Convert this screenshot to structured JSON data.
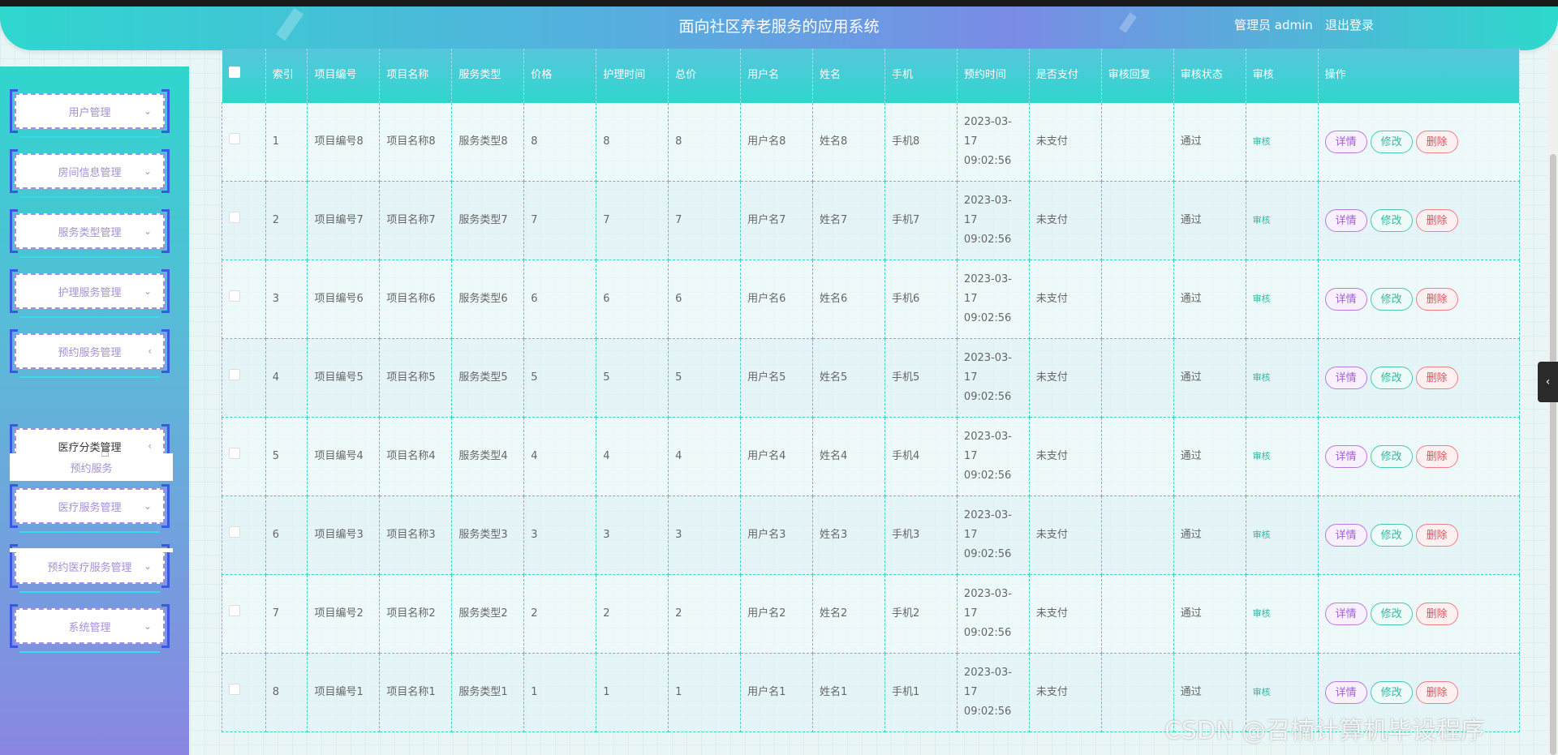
{
  "header": {
    "title": "面向社区养老服务的应用系统",
    "user_label": "管理员 admin",
    "logout_label": "退出登录"
  },
  "sidebar": {
    "items": [
      {
        "label": "用户管理",
        "chevron": "⌄"
      },
      {
        "label": "房间信息管理",
        "chevron": "⌄"
      },
      {
        "label": "服务类型管理",
        "chevron": "⌄"
      },
      {
        "label": "护理服务管理",
        "chevron": "⌄"
      },
      {
        "label": "预约服务管理",
        "chevron": "‹"
      },
      {
        "label": "医疗分类管理",
        "chevron": "‹"
      },
      {
        "label": "医疗服务管理",
        "chevron": "⌄"
      },
      {
        "label": "预约医疗服务管理",
        "chevron": "⌄"
      },
      {
        "label": "系统管理",
        "chevron": "⌄"
      }
    ],
    "sub_item": "预约服务"
  },
  "table": {
    "columns": [
      "索引",
      "项目编号",
      "项目名称",
      "服务类型",
      "价格",
      "护理时间",
      "总价",
      "用户名",
      "姓名",
      "手机",
      "预约时间",
      "是否支付",
      "审核回复",
      "审核状态",
      "审核",
      "操作"
    ],
    "rows": [
      {
        "idx": "1",
        "code": "项目编号8",
        "name": "项目名称8",
        "type": "服务类型8",
        "price": "8",
        "time": "8",
        "total": "8",
        "username": "用户名8",
        "realname": "姓名8",
        "phone": "手机8",
        "date": "2023-03-17 09:02:56",
        "paid": "未支付",
        "reply": "",
        "status": "通过"
      },
      {
        "idx": "2",
        "code": "项目编号7",
        "name": "项目名称7",
        "type": "服务类型7",
        "price": "7",
        "time": "7",
        "total": "7",
        "username": "用户名7",
        "realname": "姓名7",
        "phone": "手机7",
        "date": "2023-03-17 09:02:56",
        "paid": "未支付",
        "reply": "",
        "status": "通过"
      },
      {
        "idx": "3",
        "code": "项目编号6",
        "name": "项目名称6",
        "type": "服务类型6",
        "price": "6",
        "time": "6",
        "total": "6",
        "username": "用户名6",
        "realname": "姓名6",
        "phone": "手机6",
        "date": "2023-03-17 09:02:56",
        "paid": "未支付",
        "reply": "",
        "status": "通过"
      },
      {
        "idx": "4",
        "code": "项目编号5",
        "name": "项目名称5",
        "type": "服务类型5",
        "price": "5",
        "time": "5",
        "total": "5",
        "username": "用户名5",
        "realname": "姓名5",
        "phone": "手机5",
        "date": "2023-03-17 09:02:56",
        "paid": "未支付",
        "reply": "",
        "status": "通过"
      },
      {
        "idx": "5",
        "code": "项目编号4",
        "name": "项目名称4",
        "type": "服务类型4",
        "price": "4",
        "time": "4",
        "total": "4",
        "username": "用户名4",
        "realname": "姓名4",
        "phone": "手机4",
        "date": "2023-03-17 09:02:56",
        "paid": "未支付",
        "reply": "",
        "status": "通过"
      },
      {
        "idx": "6",
        "code": "项目编号3",
        "name": "项目名称3",
        "type": "服务类型3",
        "price": "3",
        "time": "3",
        "total": "3",
        "username": "用户名3",
        "realname": "姓名3",
        "phone": "手机3",
        "date": "2023-03-17 09:02:56",
        "paid": "未支付",
        "reply": "",
        "status": "通过"
      },
      {
        "idx": "7",
        "code": "项目编号2",
        "name": "项目名称2",
        "type": "服务类型2",
        "price": "2",
        "time": "2",
        "total": "2",
        "username": "用户名2",
        "realname": "姓名2",
        "phone": "手机2",
        "date": "2023-03-17 09:02:56",
        "paid": "未支付",
        "reply": "",
        "status": "通过"
      },
      {
        "idx": "8",
        "code": "项目编号1",
        "name": "项目名称1",
        "type": "服务类型1",
        "price": "1",
        "time": "1",
        "total": "1",
        "username": "用户名1",
        "realname": "姓名1",
        "phone": "手机1",
        "date": "2023-03-17 09:02:56",
        "paid": "未支付",
        "reply": "",
        "status": "通过"
      }
    ],
    "audit_label": "审核",
    "actions": {
      "detail": "详情",
      "edit": "修改",
      "delete": "删除"
    }
  },
  "watermark": "CSDN @召楠计算机毕设程序",
  "icons": {
    "collapse": "chevron-left-icon",
    "cursor": "hand-pointer-icon"
  },
  "colors": {
    "accent_teal": "#2fd6cd",
    "accent_purple": "#8a86e2",
    "delete_red": "#e2515f"
  }
}
